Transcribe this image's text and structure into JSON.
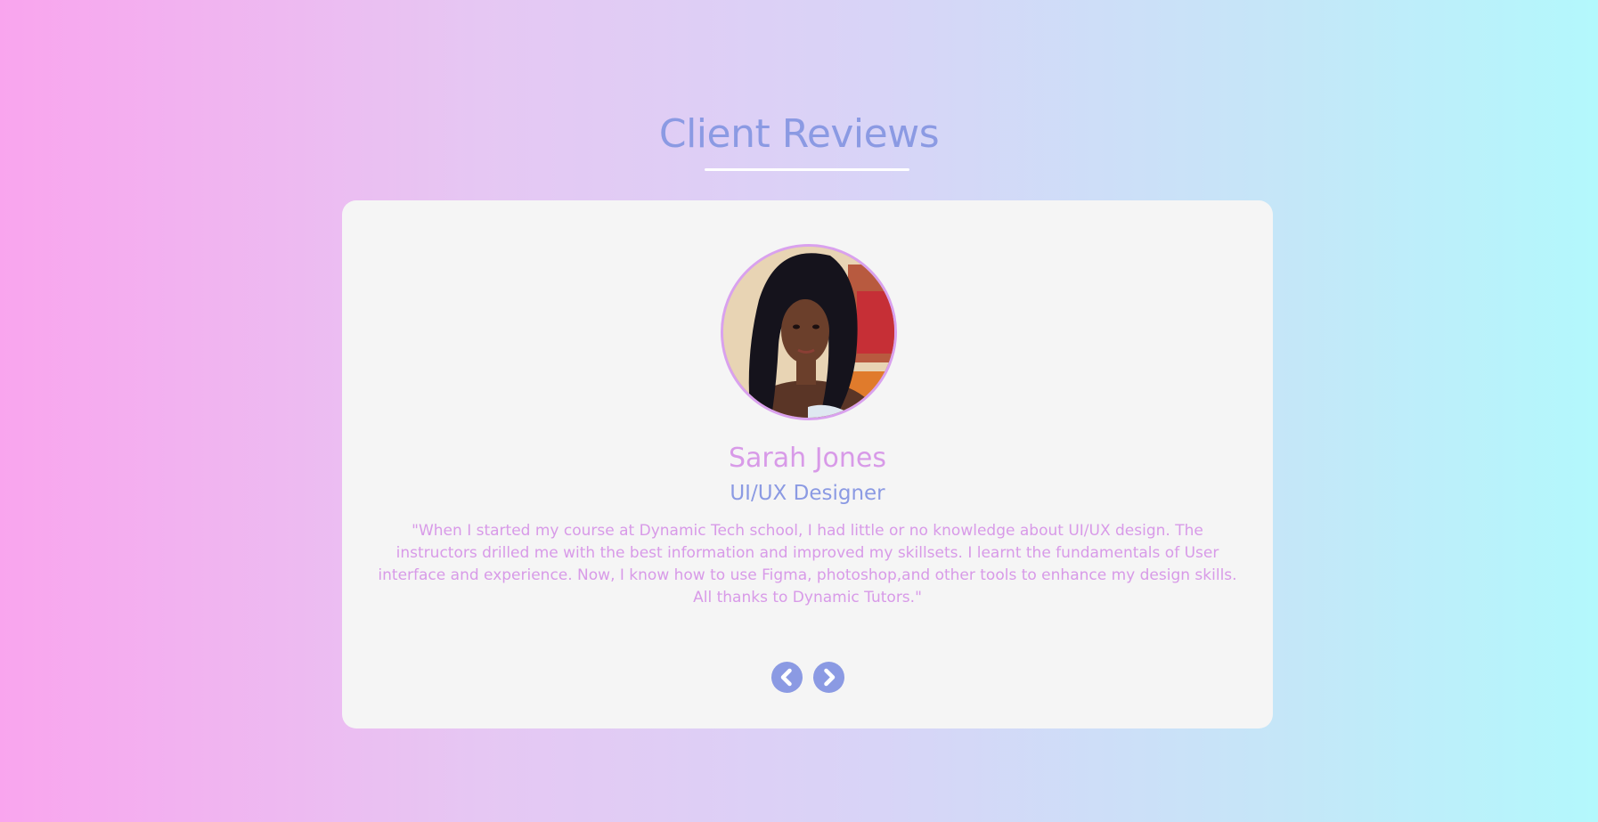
{
  "header": {
    "title": "Client Reviews"
  },
  "review": {
    "name": "Sarah Jones",
    "role": "UI/UX Designer",
    "quote": "\"When I started my course at Dynamic Tech school, I had little or no knowledge about UI/UX design. The instructors drilled me with the best information and improved my skillsets. I learnt the fundamentals of User interface and experience. Now, I know how to use Figma, photoshop,and other tools to enhance my design skills. All thanks to Dynamic Tutors.\""
  },
  "navigation": {
    "prev_icon": "chevron-left-icon",
    "next_icon": "chevron-right-icon"
  },
  "colors": {
    "accent_blue": "#8b9ae3",
    "accent_pink": "#d89ae8",
    "card_background": "#f5f5f5"
  }
}
